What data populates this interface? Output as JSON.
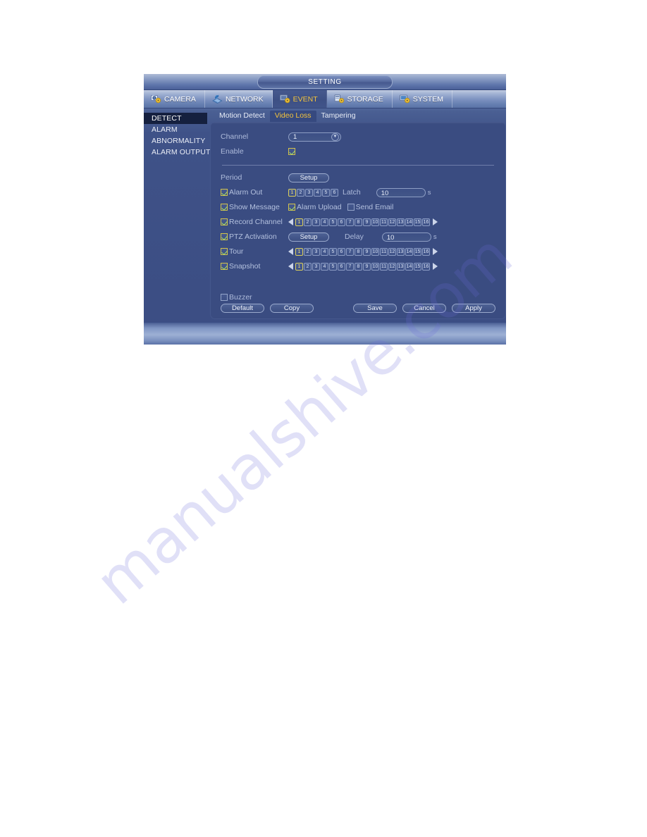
{
  "window": {
    "title": "SETTING"
  },
  "main_tabs": [
    {
      "label": "CAMERA",
      "icon": "camera-gear-icon",
      "active": false
    },
    {
      "label": "NETWORK",
      "icon": "network-icon",
      "active": false
    },
    {
      "label": "EVENT",
      "icon": "event-gear-icon",
      "active": true
    },
    {
      "label": "STORAGE",
      "icon": "storage-gear-icon",
      "active": false
    },
    {
      "label": "SYSTEM",
      "icon": "system-gear-icon",
      "active": false
    }
  ],
  "sidebar": {
    "items": [
      {
        "label": "DETECT",
        "active": true
      },
      {
        "label": "ALARM",
        "active": false
      },
      {
        "label": "ABNORMALITY",
        "active": false
      },
      {
        "label": "ALARM OUTPUT",
        "active": false
      }
    ]
  },
  "sub_tabs": [
    {
      "label": "Motion Detect",
      "active": false
    },
    {
      "label": "Video Loss",
      "active": true
    },
    {
      "label": "Tampering",
      "active": false
    }
  ],
  "form": {
    "channel": {
      "label": "Channel",
      "value": "1",
      "caret": "▼"
    },
    "enable": {
      "label": "Enable",
      "checked": true
    },
    "period": {
      "label": "Period",
      "button_label": "Setup"
    },
    "alarm_out": {
      "label": "Alarm Out",
      "checked": true,
      "channels": [
        "1",
        "2",
        "3",
        "4",
        "5",
        "6"
      ],
      "selected": [
        "1"
      ]
    },
    "latch": {
      "label": "Latch",
      "value": "10",
      "unit": "s"
    },
    "show_message": {
      "label": "Show Message",
      "checked": true
    },
    "alarm_upload": {
      "label": "Alarm Upload",
      "checked": true
    },
    "send_email": {
      "label": "Send Email",
      "checked": false
    },
    "record_channel": {
      "label": "Record Channel",
      "checked": true,
      "channels": [
        "1",
        "2",
        "3",
        "4",
        "5",
        "6",
        "7",
        "8",
        "9",
        "10",
        "11",
        "12",
        "13",
        "14",
        "15",
        "16"
      ],
      "selected": [
        "1"
      ],
      "arrow_left": "◀",
      "arrow_right": "▶"
    },
    "ptz_activation": {
      "label": "PTZ Activation",
      "checked": true,
      "button_label": "Setup"
    },
    "delay": {
      "label": "Delay",
      "value": "10",
      "unit": "s"
    },
    "tour": {
      "label": "Tour",
      "checked": true,
      "channels": [
        "1",
        "2",
        "3",
        "4",
        "5",
        "6",
        "7",
        "8",
        "9",
        "10",
        "11",
        "12",
        "13",
        "14",
        "15",
        "16"
      ],
      "selected": [
        "1"
      ]
    },
    "snapshot": {
      "label": "Snapshot",
      "checked": true,
      "channels": [
        "1",
        "2",
        "3",
        "4",
        "5",
        "6",
        "7",
        "8",
        "9",
        "10",
        "11",
        "12",
        "13",
        "14",
        "15",
        "16"
      ],
      "selected": [
        "1"
      ]
    },
    "buzzer": {
      "label": "Buzzer",
      "checked": false
    }
  },
  "footer": {
    "default_label": "Default",
    "copy_label": "Copy",
    "save_label": "Save",
    "cancel_label": "Cancel",
    "apply_label": "Apply"
  },
  "watermark": {
    "text": "manualshive.com"
  },
  "colors": {
    "accent_gold": "#f3c33c",
    "panel_bg": "#3a4c81",
    "window_bg": "#3f5288",
    "sidebar_active_bg": "#15203f",
    "check_green": "#a9e06a",
    "check_border": "#d2c24a"
  }
}
